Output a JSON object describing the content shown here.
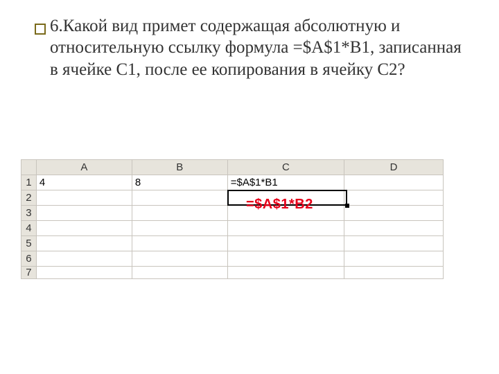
{
  "question": "6.Какой вид примет содержащая абсолютную и относительную ссылку формула =$A$1*B1, записанная в ячейке С1, после ее копирования в ячейку С2?",
  "answer_overlay": "=$A$1*B2",
  "columns": {
    "A": "A",
    "B": "B",
    "C": "C",
    "D": "D"
  },
  "rows": {
    "r1": "1",
    "r2": "2",
    "r3": "3",
    "r4": "4",
    "r5": "5",
    "r6": "6",
    "r7": "7"
  },
  "cells": {
    "A1": "4",
    "B1": "8",
    "C1": "=$A$1*B1"
  },
  "chart_data": {
    "type": "table",
    "headers": [
      "",
      "A",
      "B",
      "C",
      "D"
    ],
    "rows": [
      [
        "1",
        "4",
        "8",
        "=$A$1*B1",
        ""
      ],
      [
        "2",
        "",
        "",
        "=$A$1*B2",
        ""
      ],
      [
        "3",
        "",
        "",
        "",
        ""
      ],
      [
        "4",
        "",
        "",
        "",
        ""
      ],
      [
        "5",
        "",
        "",
        "",
        ""
      ],
      [
        "6",
        "",
        "",
        "",
        ""
      ]
    ],
    "selected_cell": "C2",
    "note": "Row 2 C-cell holds the answer formula shown as red overlay"
  }
}
